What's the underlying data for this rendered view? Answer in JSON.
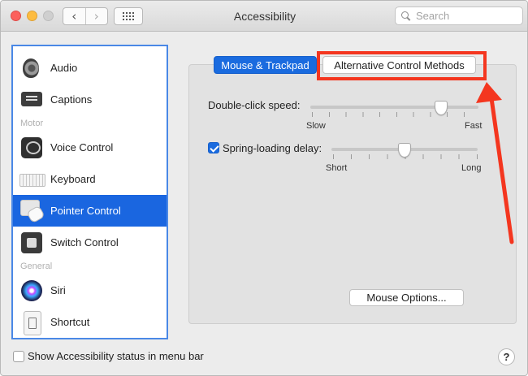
{
  "window": {
    "title": "Accessibility"
  },
  "search": {
    "placeholder": "Search"
  },
  "toolbar": {
    "back_icon": "chevron-left-icon",
    "forward_icon": "chevron-right-icon",
    "show_all_icon": "grid-icon"
  },
  "sidebar": {
    "items": [
      {
        "label": "Audio",
        "icon": "speaker-icon"
      },
      {
        "label": "Captions",
        "icon": "captions-icon"
      },
      {
        "label": "Voice Control",
        "icon": "voice-control-icon"
      },
      {
        "label": "Keyboard",
        "icon": "keyboard-icon"
      },
      {
        "label": "Pointer Control",
        "icon": "pointer-control-icon",
        "selected": true
      },
      {
        "label": "Switch Control",
        "icon": "switch-control-icon"
      },
      {
        "label": "Siri",
        "icon": "siri-icon"
      },
      {
        "label": "Shortcut",
        "icon": "shortcut-icon"
      }
    ],
    "headers": {
      "motor": "Motor",
      "general": "General"
    }
  },
  "tabs": {
    "mouse": "Mouse & Trackpad",
    "alt": "Alternative Control Methods",
    "selected": "mouse"
  },
  "double_click": {
    "label": "Double-click speed:",
    "min_label": "Slow",
    "max_label": "Fast",
    "value_fraction": 0.78
  },
  "spring_loading": {
    "label": "Spring-loading delay:",
    "checked": true,
    "min_label": "Short",
    "max_label": "Long",
    "value_fraction": 0.5
  },
  "mouse_options_label": "Mouse Options...",
  "status_bar": {
    "label": "Show Accessibility status in menu bar",
    "checked": false
  },
  "help_label": "?",
  "colors": {
    "accent": "#1a6bdf",
    "annotation": "#f4361f"
  }
}
